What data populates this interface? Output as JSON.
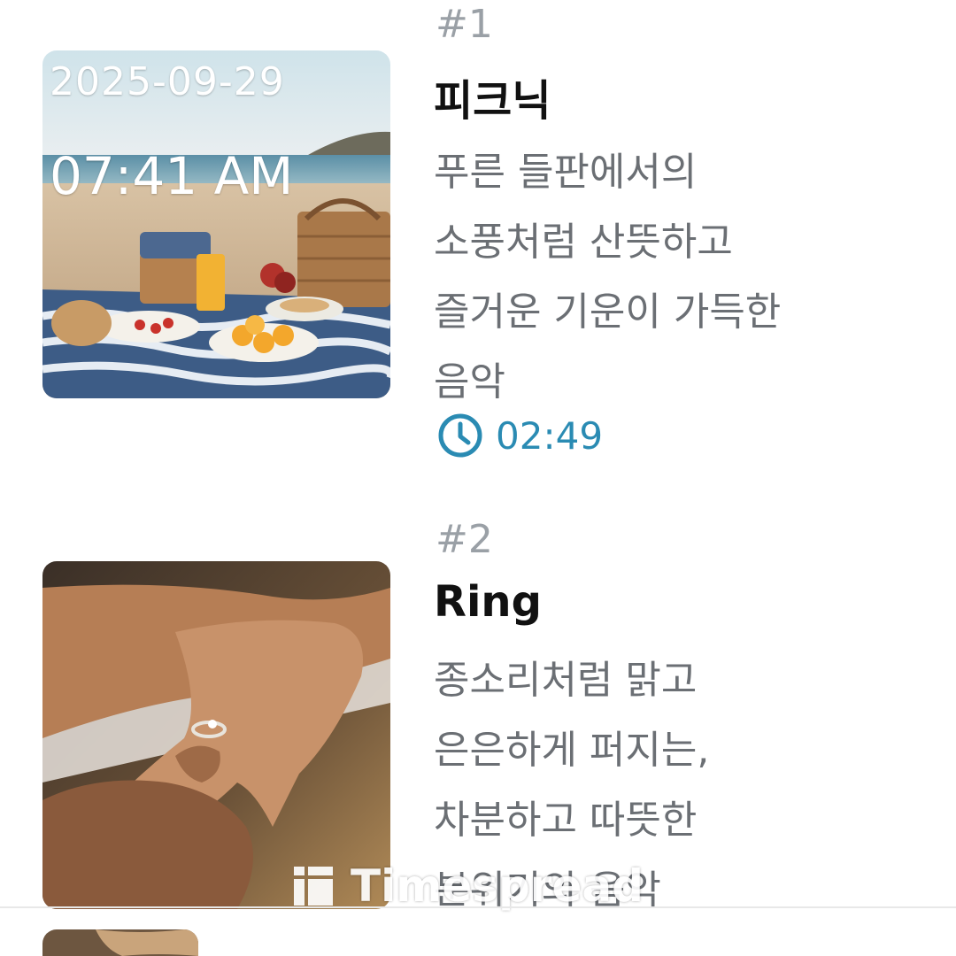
{
  "tracks": [
    {
      "rank": "#1",
      "date_stamp": "2025-09-29",
      "time_stamp": "07:41 AM",
      "title": "피크닉",
      "description": [
        "푸른 들판에서의",
        "소풍처럼 산뜻하고",
        "즐거운 기운이 가득한",
        "음악"
      ],
      "duration": "02:49",
      "image": "beach-picnic-image"
    },
    {
      "rank": "#2",
      "title": "Ring",
      "description": [
        "종소리처럼 맑고",
        "은은하게 퍼지는,",
        "차분하고 따뜻한",
        "분위기의 음악"
      ],
      "image": "ring-hands-image"
    }
  ],
  "watermark": {
    "text": "Timespread",
    "icon": "timespread-logo-icon"
  },
  "colors": {
    "accent": "#2a8bb3",
    "rank": "#9aa0a6",
    "title": "#111111",
    "desc": "#6b6f74"
  }
}
